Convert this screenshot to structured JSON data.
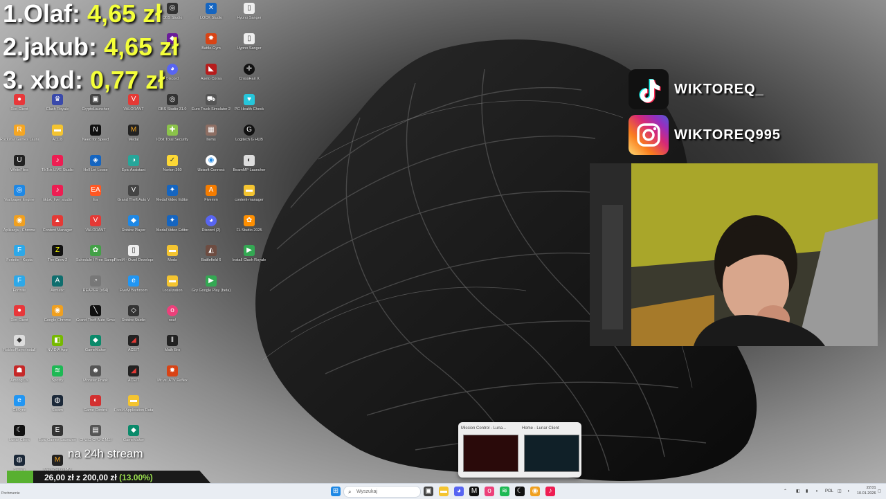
{
  "leaderboard": [
    {
      "rank_name": "1.Olaf:",
      "amount": "4,65 zł"
    },
    {
      "rank_name": "2.jakub:",
      "amount": "4,65 zł"
    },
    {
      "rank_name": "3. xbd:",
      "amount": "0,77 zł"
    }
  ],
  "socials": {
    "tiktok_handle": "WIKTOREQ_",
    "instagram_handle": "WIKTOREQ995"
  },
  "desktop_icons": {
    "c0": [
      "Riot Client",
      "Rockstar Games Launcher",
      "WhiteFiles",
      "Wallpaper Engine",
      "Aplikacja - Chrome",
      "Fortnite - Kopia",
      "Fortnite",
      "Riot Client",
      "RobloxPlayerInstall",
      "Among Us",
      "GitSync",
      "Lunar Client",
      "Steam"
    ],
    "c1": [
      "Clash Royale",
      "ACLib",
      "TikTok LIVE Studio",
      "tiktok_live_studio",
      "Content Manager",
      "The Crew 2",
      "Airmatic",
      "Google Chrome",
      "NVIDIA App",
      "Spotify",
      "Steam",
      "Epic Games Launcher",
      "MediaSetup MM"
    ],
    "c2": [
      "CryptoLauncher",
      "Need for Speed",
      "Hell Let Loose",
      "Ea",
      "VALORANT",
      "Schedule I Free Sample",
      "REAPER (x64)",
      "Grand Theft Auto Simulator",
      "GameMaker",
      "Monster Prank",
      "Game Control",
      "CPUID CPU-Z MSI"
    ],
    "c3": [
      "VALORANT",
      "Medal",
      "Epic Assistant",
      "Grand Theft Auto V",
      "Roblox Player",
      "FiveM - Orzel Developer",
      "FiveM Bathroom",
      "Roblox Studio",
      "ACEIT",
      "ACEIT",
      "FiveM Application Data",
      "GameMaker"
    ],
    "c4": [
      "OBS Studio 31.0",
      "IObit Total Security",
      "Norton 360",
      "Medal Video Editor",
      "Medal Video Editor",
      "Mods",
      "Localization",
      "osu!",
      "Math Bro",
      "Mr vs. ATV Reflex"
    ],
    "c5": [
      "Euro Truck Simulator 2",
      "Items",
      "Ubisoft Connect",
      "Fivemm",
      "Discord (2)",
      "Battlefield 6",
      "Gry Google Play (beta)"
    ],
    "c6": [
      "PC Health Check",
      "Logitech G HUB",
      "BeamMP Launcher",
      "content-manager",
      "FL Studio 2025",
      "Install Clash Royale"
    ],
    "top": [
      "",
      "",
      "",
      "LOCK Studio",
      "Hypno Sanger",
      "Battle-Gym",
      "Aseto Corsa",
      "CrossHair X",
      "OBS Studio",
      "Discord",
      "Discord",
      "Discord",
      "Discord"
    ]
  },
  "webcam": {
    "label": "webcam"
  },
  "thumbnails": [
    {
      "title": "Mission Control - Luna..."
    },
    {
      "title": "Home - Lunar Client"
    }
  ],
  "goal": {
    "title": "na 24h stream",
    "current": "26,00 zł",
    "sep": "z",
    "target": "200,00 zł",
    "percent_label": "(13.00%)",
    "progress": 0.13
  },
  "taskbar": {
    "search_placeholder": "Wyszukaj",
    "lang": "POL",
    "time": "22:01",
    "date": "10.01.2026",
    "bottom_left": "Pochmurnie"
  },
  "colors": {
    "amount": "#f4ff3a",
    "goal_fill": "#58b030",
    "pct": "#9be04e"
  }
}
